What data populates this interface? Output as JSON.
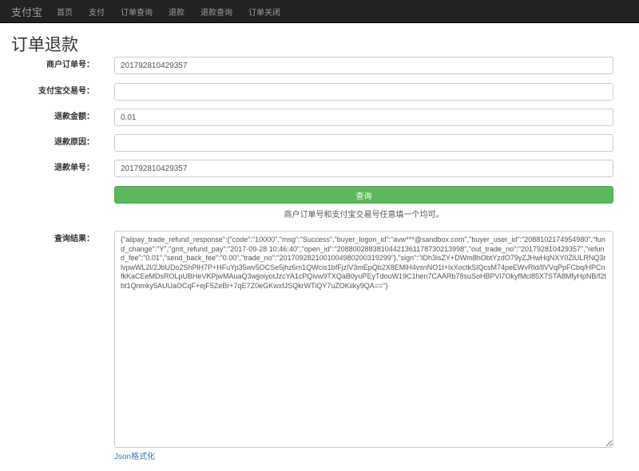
{
  "nav": {
    "brand": "支付宝",
    "items": [
      "首页",
      "支付",
      "订单查询",
      "退款",
      "退款查询",
      "订单关闭"
    ]
  },
  "page_title": "订单退款",
  "form": {
    "fields": [
      {
        "label": "商户订单号：",
        "value": ""
      },
      {
        "label": "支付宝交易号：",
        "value": ""
      },
      {
        "label": "退款金额：",
        "value": "0.01"
      },
      {
        "label": "退款原因：",
        "value": ""
      },
      {
        "label": "退款单号：",
        "value": "201792810429357"
      }
    ],
    "merchant_order_no": "201792810429357",
    "submit_label": "查询",
    "help_text": "商户订单号和支付宝交易号任意填一个均可。"
  },
  "result": {
    "label": "查询结果：",
    "value": "{\"alipay_trade_refund_response\":{\"code\":\"10000\",\"msg\":\"Success\",\"buyer_logon_id\":\"avw***@sandbox.com\",\"buyer_user_id\":\"2088102174954980\",\"fund_change\":\"Y\",\"gmt_refund_pay\":\"2017-09-28 10:46:40\",\"open_id\":\"20880028838104421361178730213998\",\"out_trade_no\":\"201792810429357\",\"refund_fee\":\"0.01\",\"send_back_fee\":\"0.00\",\"trade_no\":\"2017092821001004980200319299\"},\"sign\":\"IDh3isZY+DWm8hObtYzdO79yZJHwHqNXY0ZlULRNQ3rlvpwWL2l/2JbUDo2ShPlH7P+HFuYp35wv5OCSe5jhz6m1QWcis1bfFjzlV3mEpQb2X8EMlH4vsnNO1t+lxXoctkSIQcsM74peEWvRld/llVVqPpFCbq/HPCnfkKaCEeMDsROLpUBHeVKPjwMAuaQ3wjjoiyotJzcYA1cPQivw9TXQaB0yuPEyTdouW19C1hen7CAARb78suSoHBPVl7OkyfMcl85X7STA8MfyHpNB/f2tbt1Qnmky5AUUaOCqF+ejF5ZeBr+7qE7Z0eGKwxfJSQkrWTiQY7uZOKiiky9QA==\"}",
    "json_format_link": "Json格式化"
  }
}
